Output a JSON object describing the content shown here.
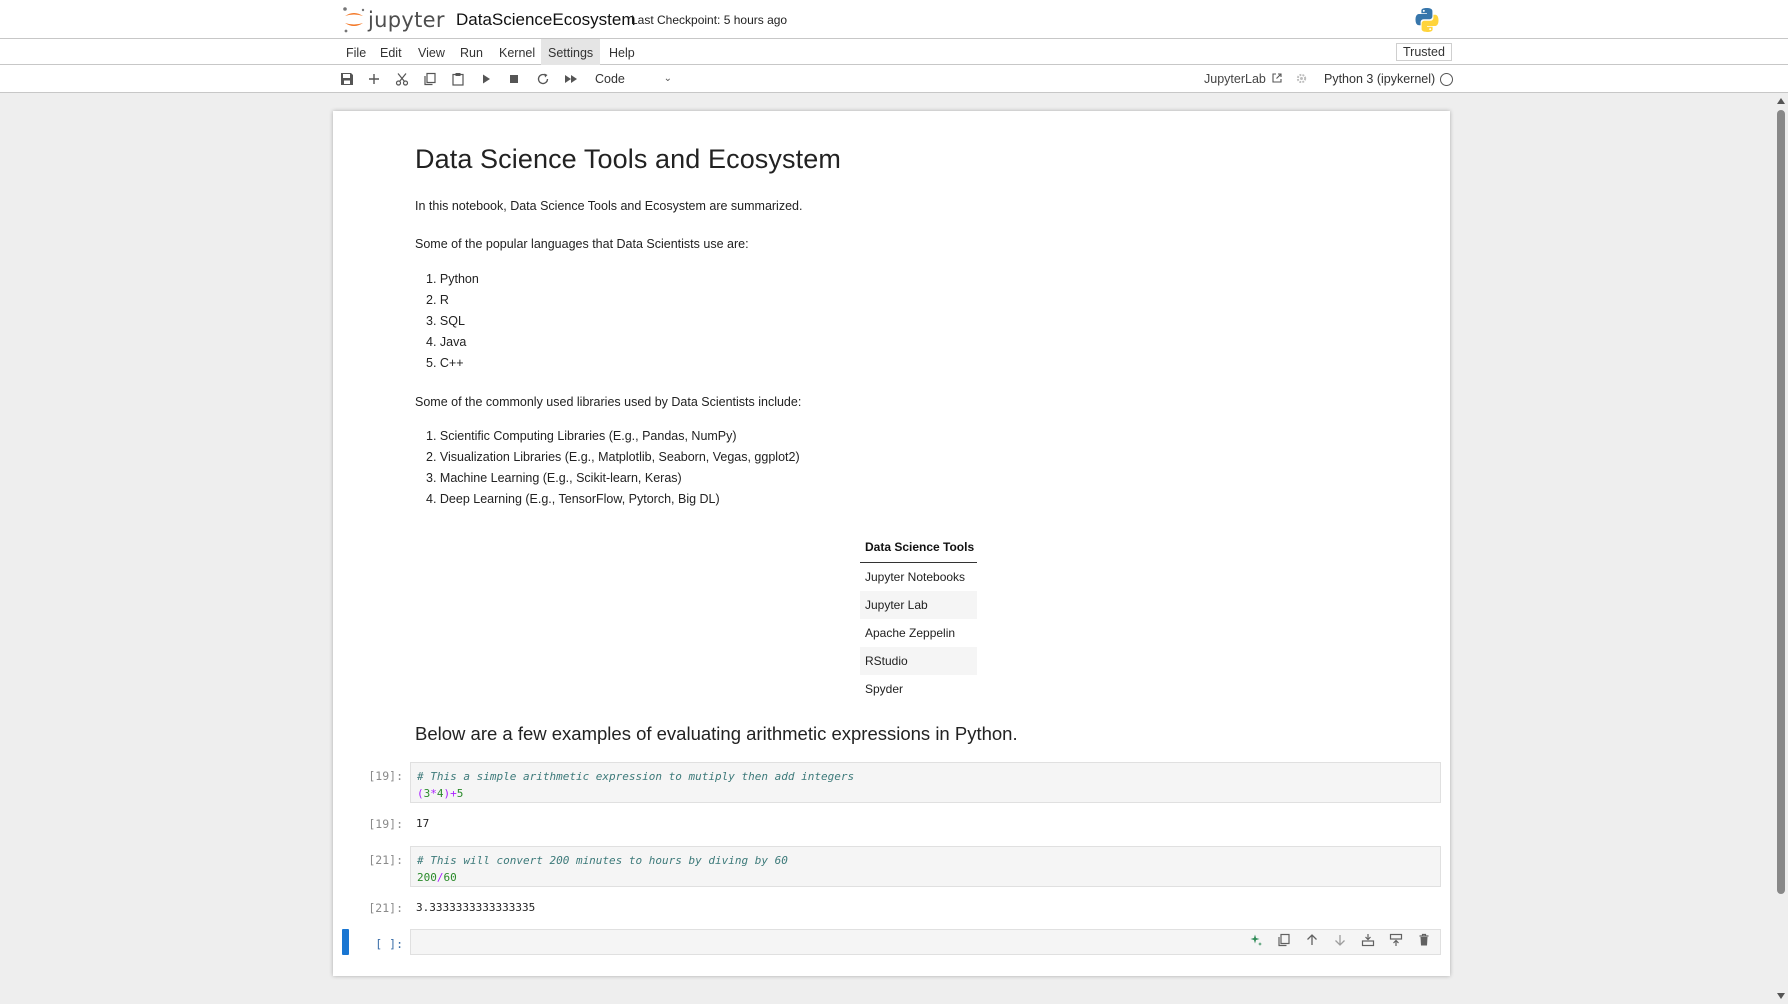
{
  "header": {
    "logo_text": "jupyter",
    "notebook_title": "DataScienceEcosystem",
    "checkpoint": "Last Checkpoint: 5 hours ago"
  },
  "menu": {
    "items": [
      "File",
      "Edit",
      "View",
      "Run",
      "Kernel",
      "Settings",
      "Help"
    ],
    "active": "Settings",
    "trusted_label": "Trusted"
  },
  "toolbar": {
    "icons": [
      "save-icon",
      "add-cell-icon",
      "cut-icon",
      "copy-icon",
      "paste-icon",
      "run-icon",
      "stop-icon",
      "restart-icon",
      "run-all-icon"
    ],
    "cell_type": "Code",
    "jupyterlab_label": "JupyterLab",
    "kernel_label": "Python 3 (ipykernel)"
  },
  "notebook": {
    "title": "Data Science Tools and Ecosystem",
    "intro": "In this notebook, Data Science Tools and Ecosystem are summarized.",
    "languages_heading": "Some of the popular languages that Data Scientists use are:",
    "languages": [
      "Python",
      "R",
      "SQL",
      "Java",
      "C++"
    ],
    "libraries_heading": "Some of the commonly used libraries used by Data Scientists include:",
    "libraries": [
      "Scientific Computing Libraries (E.g., Pandas, NumPy)",
      "Visualization Libraries (E.g., Matplotlib, Seaborn, Vegas, ggplot2)",
      "Machine Learning (E.g., Scikit-learn, Keras)",
      "Deep Learning (E.g., TensorFlow, Pytorch, Big DL)"
    ],
    "tools_table": {
      "header": "Data Science Tools",
      "rows": [
        "Jupyter Notebooks",
        "Jupyter Lab",
        "Apache Zeppelin",
        "RStudio",
        "Spyder"
      ]
    },
    "examples_heading": "Below are a few examples of evaluating arithmetic expressions in Python.",
    "cells": [
      {
        "prompt": "[19]:",
        "comment": "# This a simple arithmetic expression to mutiply then add integers",
        "code": "(3*4)+5",
        "output_prompt": "[19]:",
        "output": "17"
      },
      {
        "prompt": "[21]:",
        "comment": "# This will convert 200 minutes to hours by diving by 60",
        "code": "200/60",
        "output_prompt": "[21]:",
        "output": "3.3333333333333335"
      }
    ],
    "empty_prompt": "[ ]:"
  },
  "colors": {
    "accent": "#1976d2",
    "jupyter_orange": "#f37726",
    "code_bg": "#f5f5f5"
  }
}
